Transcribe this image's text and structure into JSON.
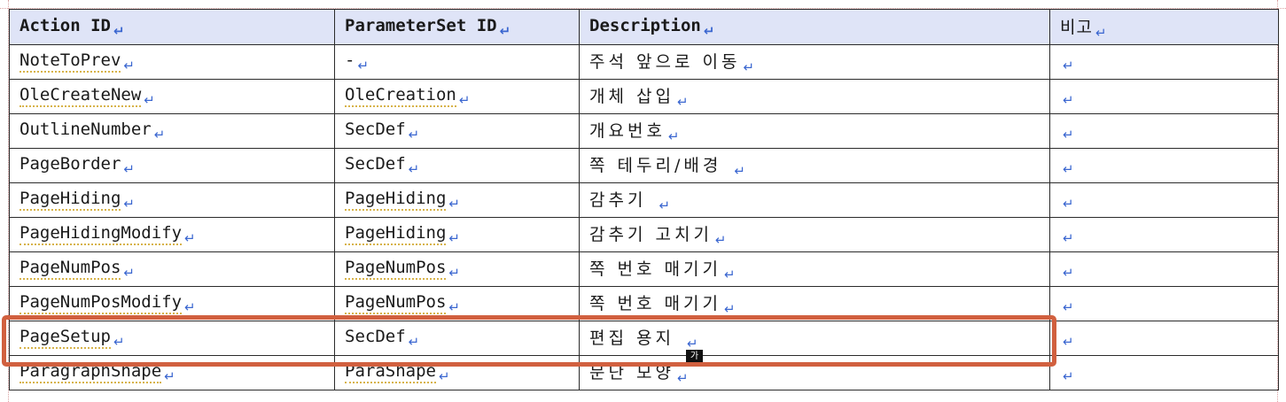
{
  "table": {
    "headers": [
      "Action ID",
      "ParameterSet ID",
      "Description",
      "비고"
    ],
    "rows": [
      {
        "action_id": "NoteToPrev",
        "parameterset_id": "-",
        "description": "주석 앞으로 이동",
        "note": ""
      },
      {
        "action_id": "OleCreateNew",
        "parameterset_id": "OleCreation",
        "description": "개체 삽입",
        "note": ""
      },
      {
        "action_id": "OutlineNumber",
        "parameterset_id": "SecDef",
        "description": "개요번호",
        "note": ""
      },
      {
        "action_id": "PageBorder",
        "parameterset_id": "SecDef",
        "description": "쪽 테두리/배경",
        "note": ""
      },
      {
        "action_id": "PageHiding",
        "parameterset_id": "PageHiding",
        "description": "감추기",
        "note": ""
      },
      {
        "action_id": "PageHidingModify",
        "parameterset_id": "PageHiding",
        "description": "감추기 고치기",
        "note": ""
      },
      {
        "action_id": "PageNumPos",
        "parameterset_id": "PageNumPos",
        "description": "쪽 번호 매기기",
        "note": ""
      },
      {
        "action_id": "PageNumPosModify",
        "parameterset_id": "PageNumPos",
        "description": "쪽 번호 매기기",
        "note": ""
      },
      {
        "action_id": "PageSetup",
        "parameterset_id": "SecDef",
        "description": "편집 용지",
        "note": ""
      },
      {
        "action_id": "ParagraphShape",
        "parameterset_id": "ParaShape",
        "description": "문단 모양",
        "note": ""
      }
    ],
    "paragraph_mark": "↵",
    "highlighted_row": "PageSetup",
    "highlight_color": "#d1603f",
    "header_bg": "#dfe4f7"
  },
  "ime_indicator": "가"
}
